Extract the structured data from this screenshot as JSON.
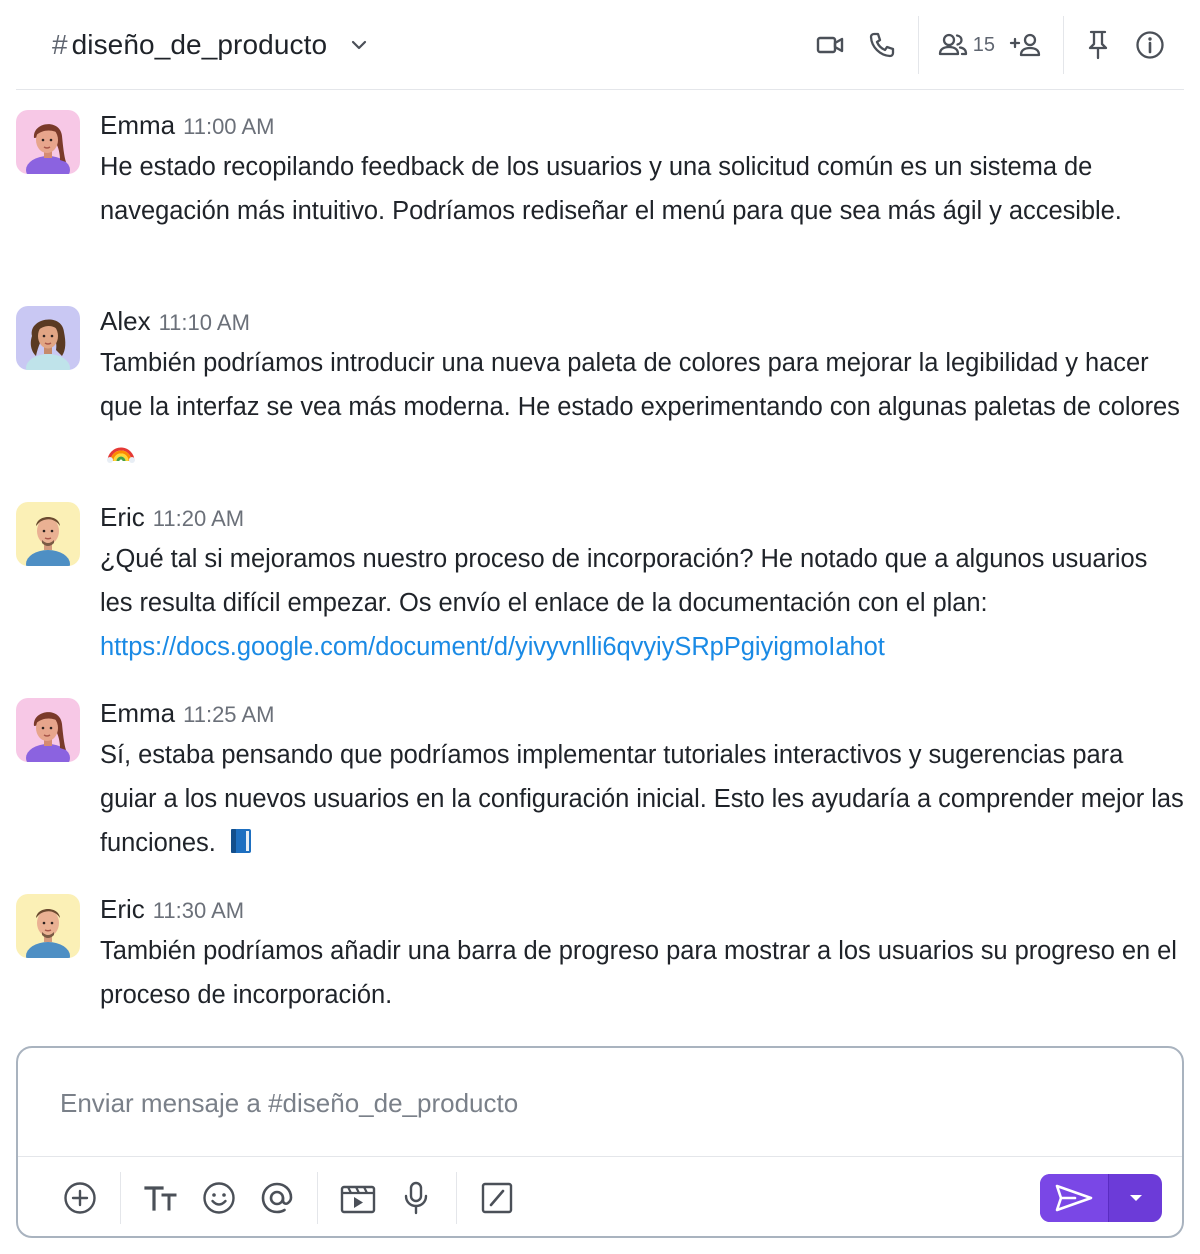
{
  "header": {
    "channel_hash": "#",
    "channel_name": "diseño_de_producto",
    "member_count": "15",
    "icons": [
      "chevron-down-icon",
      "video-camera-icon",
      "phone-icon",
      "members-icon",
      "add-member-icon",
      "pin-icon",
      "info-icon"
    ]
  },
  "messages": [
    {
      "author": "Emma",
      "time": "11:00 AM",
      "text": "He estado recopilando feedback de los usuarios y una solicitud común es un sistema de navegación más intuitivo. Podríamos rediseñar el menú para que sea más ágil y accesible."
    },
    {
      "author": "Alex",
      "time": "11:10 AM",
      "text": "También podríamos introducir una nueva paleta de colores para mejorar la legibilidad y hacer que la interfaz se vea más moderna. He estado experimentando con algunas paletas de colores",
      "emoji": "rainbow"
    },
    {
      "author": "Eric",
      "time": "11:20 AM",
      "text": "¿Qué tal si mejoramos nuestro proceso de incorporación? He notado que a algunos usuarios les resulta difícil empezar. Os envío el enlace de la documentación con el plan:",
      "link": "https://docs.google.com/document/d/yivyvnlli6qvyiySRpPgiyigmoIahot"
    },
    {
      "author": "Emma",
      "time": "11:25 AM",
      "text": "Sí, estaba pensando que podríamos implementar tutoriales interactivos y sugerencias para guiar a los nuevos usuarios en la configuración inicial. Esto les ayudaría a comprender mejor las funciones.",
      "emoji": "blue-book"
    },
    {
      "author": "Eric",
      "time": "11:30 AM",
      "text": "También podríamos añadir una barra de progreso para mostrar a los usuarios su progreso en el proceso de incorporación."
    }
  ],
  "composer": {
    "placeholder": "Enviar mensaje a #diseño_de_producto",
    "value": "",
    "toolbar_icons": [
      "add-icon",
      "text-format-icon",
      "emoji-icon",
      "mention-icon",
      "gif-icon",
      "microphone-icon",
      "slash-command-icon"
    ],
    "send_icon": "send-icon",
    "send_menu_icon": "caret-down-icon"
  },
  "colors": {
    "accent": "#7a47e6",
    "link": "#1a8ae5",
    "emma_avatar_bg": "#f7c8e6",
    "alex_avatar_bg": "#c9c8f3",
    "eric_avatar_bg": "#fbf0b6"
  }
}
